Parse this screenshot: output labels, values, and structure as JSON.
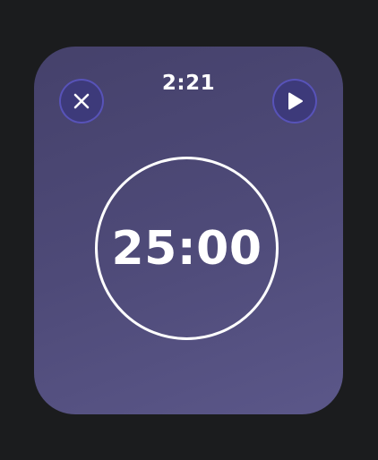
{
  "status": {
    "time": "2:21"
  },
  "controls": {
    "close_icon": "close-icon",
    "play_icon": "play-icon"
  },
  "timer": {
    "value": "25:00"
  },
  "colors": {
    "background": "#1b1c1e",
    "screen_gradient_start": "#45416b",
    "screen_gradient_end": "#5b5789",
    "button_fill": "#3d3a7a",
    "button_ring": "#5853b8",
    "foreground": "#ffffff"
  }
}
